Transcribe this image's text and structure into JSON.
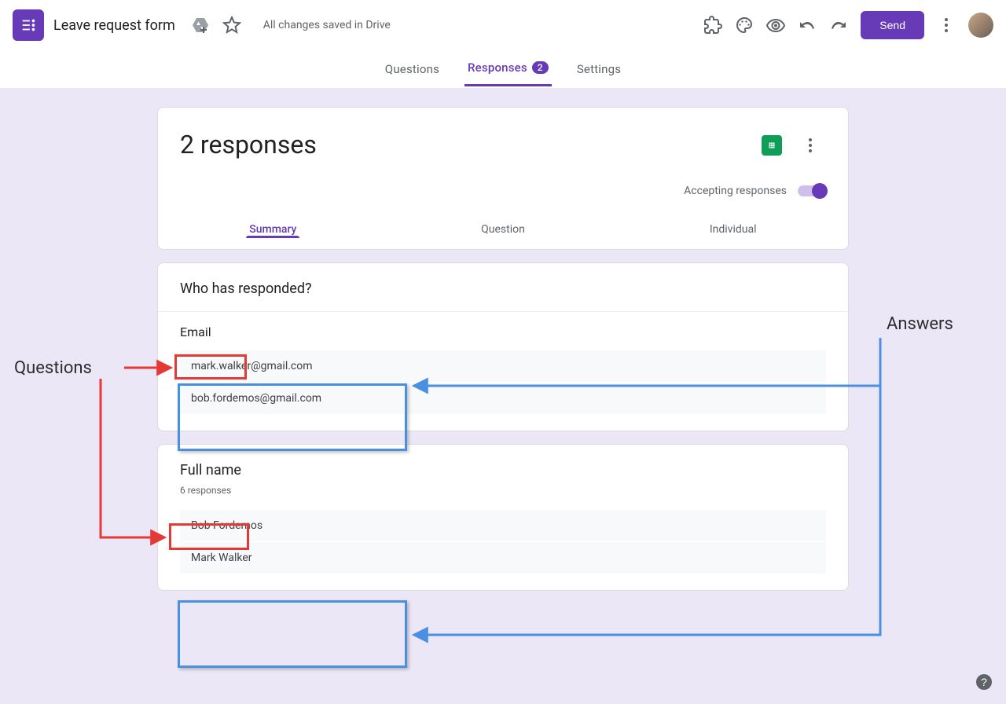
{
  "header": {
    "title": "Leave request form",
    "save_status": "All changes saved in Drive",
    "send_label": "Send"
  },
  "tabs": {
    "questions": "Questions",
    "responses": "Responses",
    "responses_badge": "2",
    "settings": "Settings"
  },
  "responses": {
    "heading": "2 responses",
    "accepting_label": "Accepting responses",
    "tabs": {
      "summary": "Summary",
      "question": "Question",
      "individual": "Individual"
    }
  },
  "section_who": {
    "title": "Who has responded?",
    "email_label": "Email",
    "email_answers": [
      "mark.walker@gmail.com",
      "bob.fordemos@gmail.com"
    ]
  },
  "section_fullname": {
    "label": "Full name",
    "responses_count": "6 responses",
    "answers": [
      "Bob Fordemos",
      "Mark Walker"
    ]
  },
  "annotations": {
    "questions_label": "Questions",
    "answers_label": "Answers"
  }
}
